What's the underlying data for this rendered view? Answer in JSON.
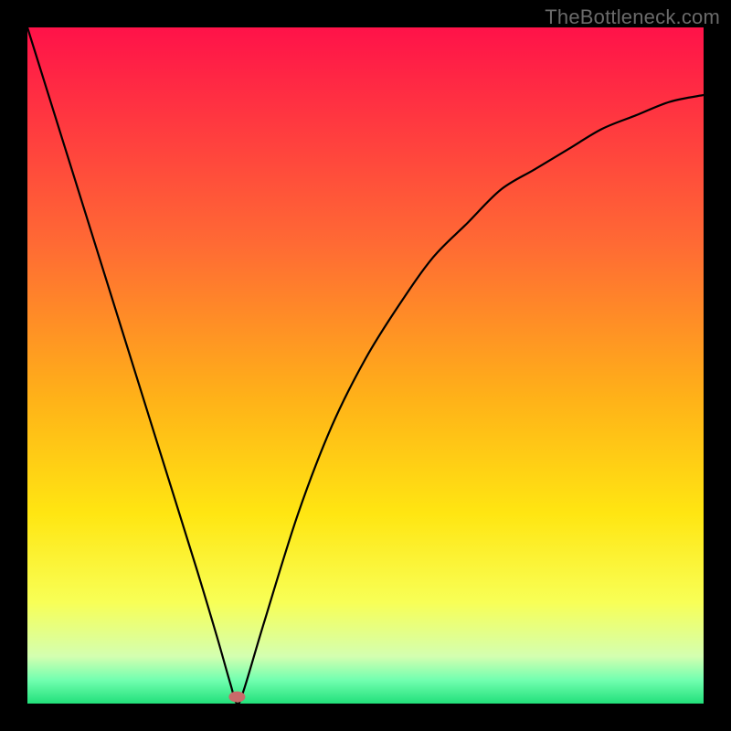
{
  "watermark": "TheBottleneck.com",
  "chart_data": {
    "type": "line",
    "title": "",
    "xlabel": "",
    "ylabel": "",
    "xlim": [
      0,
      100
    ],
    "ylim": [
      0,
      100
    ],
    "series": [
      {
        "name": "curve",
        "x": [
          0,
          5,
          10,
          15,
          20,
          25,
          28,
          30,
          31,
          32,
          35,
          40,
          45,
          50,
          55,
          60,
          65,
          70,
          75,
          80,
          85,
          90,
          95,
          100
        ],
        "values": [
          100,
          84,
          68,
          52,
          36,
          20,
          10,
          3,
          0,
          2,
          12,
          28,
          41,
          51,
          59,
          66,
          71,
          76,
          79,
          82,
          85,
          87,
          89,
          90
        ]
      }
    ],
    "marker": {
      "name": "marker",
      "x": 31,
      "y": 1,
      "color": "#c96a6a"
    },
    "gradient_stops": [
      {
        "offset": 0.0,
        "color": "#ff1249"
      },
      {
        "offset": 0.32,
        "color": "#ff6a34"
      },
      {
        "offset": 0.55,
        "color": "#ffb218"
      },
      {
        "offset": 0.72,
        "color": "#ffe612"
      },
      {
        "offset": 0.85,
        "color": "#f8ff56"
      },
      {
        "offset": 0.93,
        "color": "#d4ffb0"
      },
      {
        "offset": 0.965,
        "color": "#72ffb0"
      },
      {
        "offset": 1.0,
        "color": "#22e07a"
      }
    ]
  }
}
